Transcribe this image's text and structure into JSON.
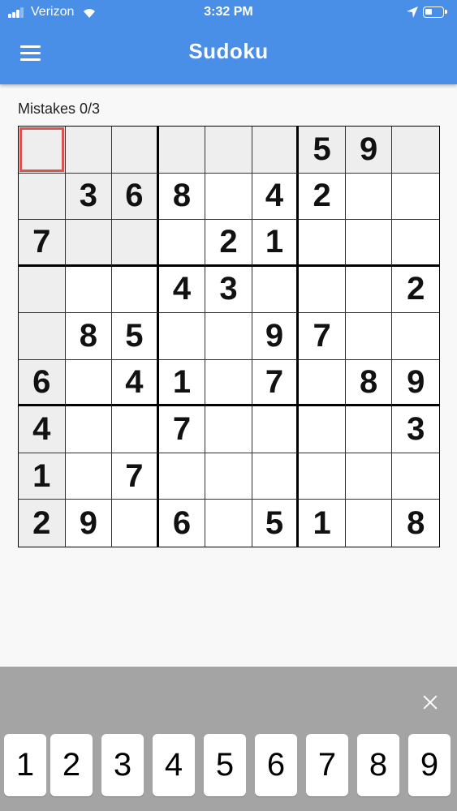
{
  "status_bar": {
    "carrier": "Verizon",
    "time": "3:32 PM"
  },
  "header": {
    "title": "Sudoku",
    "color": "#4a8fe7"
  },
  "mistakes_label": "Mistakes 0/3",
  "board": {
    "rows": [
      [
        "",
        "",
        "",
        "",
        "",
        "",
        "5",
        "9",
        ""
      ],
      [
        "",
        "3",
        "6",
        "8",
        "",
        "4",
        "2",
        "",
        ""
      ],
      [
        "7",
        "",
        "",
        "",
        "2",
        "1",
        "",
        "",
        ""
      ],
      [
        "",
        "",
        "",
        "4",
        "3",
        "",
        "",
        "",
        "2"
      ],
      [
        "",
        "8",
        "5",
        "",
        "",
        "9",
        "7",
        "",
        ""
      ],
      [
        "6",
        "",
        "4",
        "1",
        "",
        "7",
        "",
        "8",
        "9"
      ],
      [
        "4",
        "",
        "",
        "7",
        "",
        "",
        "",
        "",
        "3"
      ],
      [
        "1",
        "",
        "7",
        "",
        "",
        "",
        "",
        "",
        ""
      ],
      [
        "2",
        "9",
        "",
        "6",
        "",
        "5",
        "1",
        "",
        "8"
      ]
    ],
    "selected_cell": [
      0,
      0
    ],
    "highlight_color": "#eeeeef",
    "selection_color": "#d9534f"
  },
  "keypad": {
    "keys": [
      "1",
      "2",
      "3",
      "4",
      "5",
      "6",
      "7",
      "8",
      "9"
    ],
    "background": "#a4a4a4"
  }
}
